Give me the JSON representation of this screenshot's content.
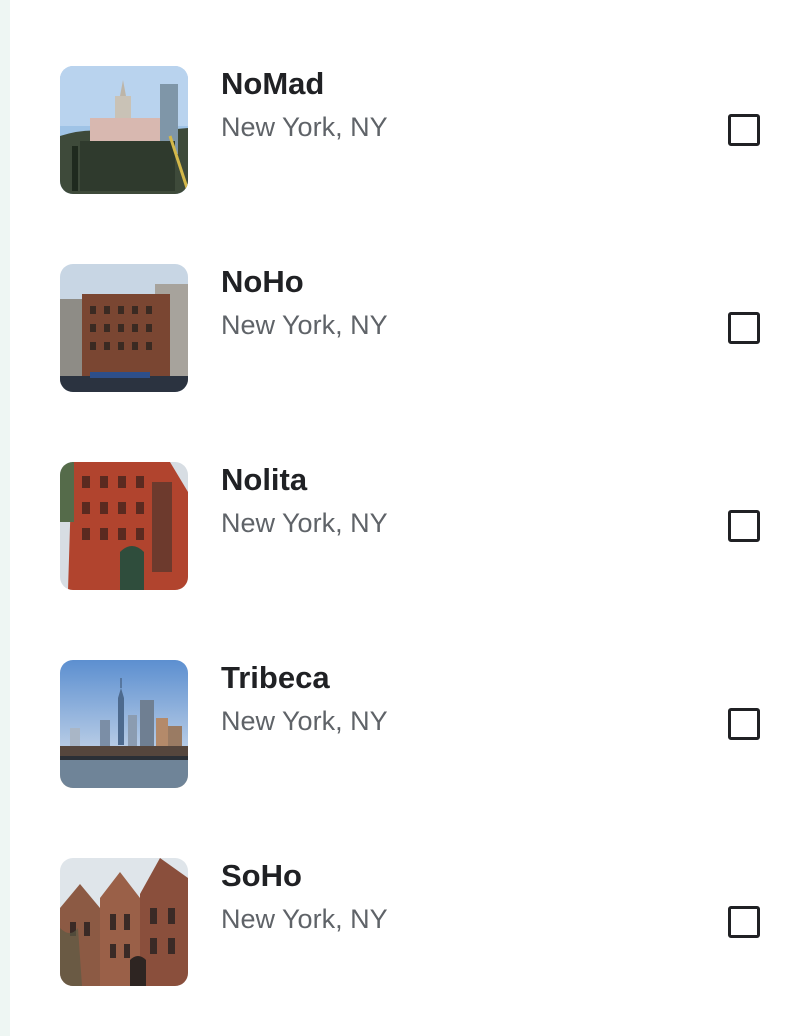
{
  "places": [
    {
      "name": "NoMad",
      "location": "New York, NY",
      "checked": false
    },
    {
      "name": "NoHo",
      "location": "New York, NY",
      "checked": false
    },
    {
      "name": "Nolita",
      "location": "New York, NY",
      "checked": false
    },
    {
      "name": "Tribeca",
      "location": "New York, NY",
      "checked": false
    },
    {
      "name": "SoHo",
      "location": "New York, NY",
      "checked": false
    }
  ],
  "colors": {
    "title": "#202124",
    "subtitle": "#5f6368",
    "rail": "#eef6f3"
  }
}
